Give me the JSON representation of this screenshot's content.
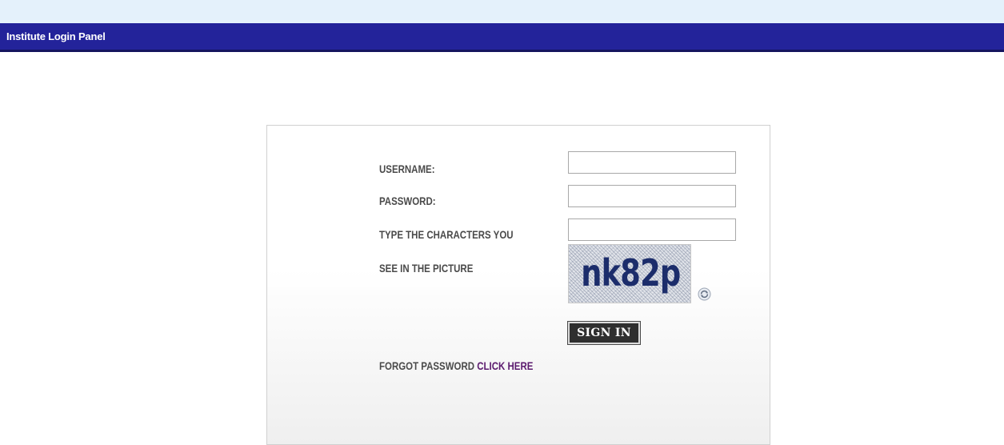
{
  "header": {
    "title": "Institute Login Panel"
  },
  "login_form": {
    "username_label": "USERNAME:",
    "username_value": "",
    "password_label": "PASSWORD:",
    "password_value": "",
    "captcha_label_line1": "TYPE THE CHARACTERS YOU",
    "captcha_label_line2": "SEE IN THE PICTURE",
    "captcha_value": "",
    "captcha_text": "nk82p",
    "refresh_icon": "refresh-icon",
    "signin_label": "SIGN IN",
    "forgot_text": "FORGOT PASSWORD",
    "forgot_link_label": "CLICK HERE"
  },
  "colors": {
    "top_strip": "#e4f1fb",
    "header_bar": "#23239a",
    "label_text": "#4a4a4a",
    "link": "#5b1a6e",
    "button_bg": "#2f2f2f",
    "captcha_text": "#1c2d6b"
  }
}
